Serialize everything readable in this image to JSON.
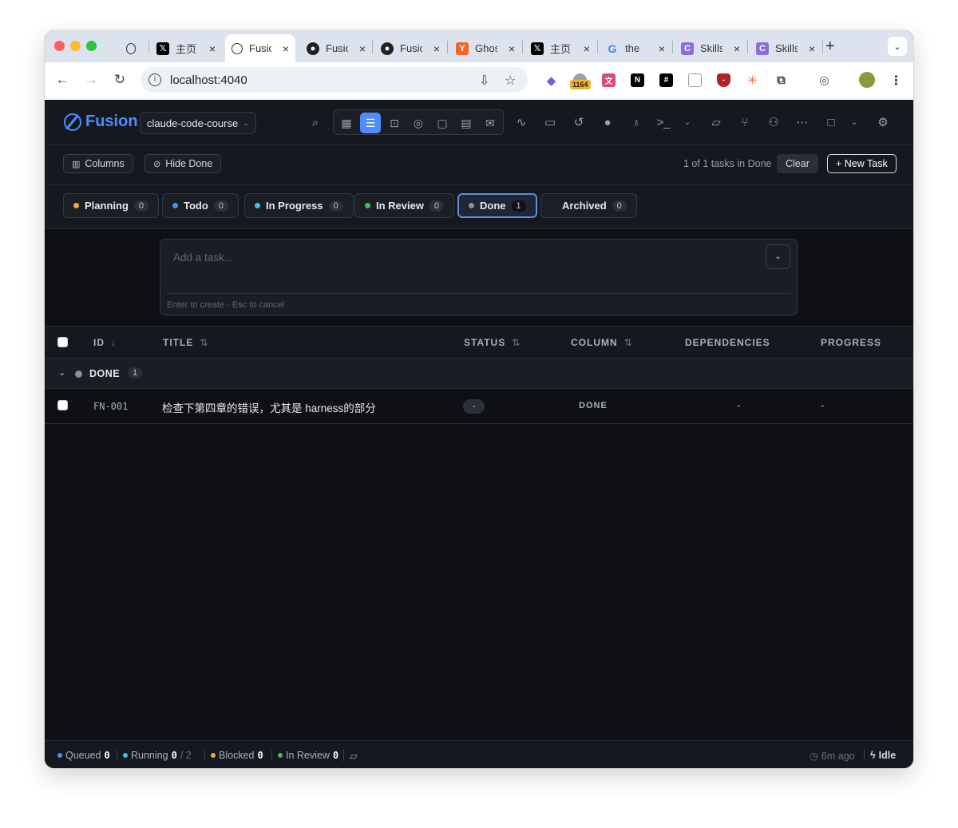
{
  "browser": {
    "tabs": [
      {
        "title": "",
        "icon": "openai-icon"
      },
      {
        "title": "主页",
        "icon": "x-icon"
      },
      {
        "title": "Fusion",
        "icon": "fusion-icon",
        "active": true
      },
      {
        "title": "Fusion",
        "icon": "github-icon"
      },
      {
        "title": "Fusion",
        "icon": "github-icon"
      },
      {
        "title": "Ghost",
        "icon": "ycombinator-icon"
      },
      {
        "title": "主页",
        "icon": "x-icon"
      },
      {
        "title": "the",
        "icon": "google-icon"
      },
      {
        "title": "Skills",
        "icon": "claude-icon"
      },
      {
        "title": "Skills",
        "icon": "claude-icon"
      }
    ],
    "tab_close_glyph": "×",
    "new_tab_glyph": "+",
    "url": "localhost:4040",
    "extension_badge": "1164"
  },
  "app": {
    "logo": "Fusion",
    "project": "claude-code-course",
    "filters": {
      "columns_label": "Columns",
      "hide_done_label": "Hide Done",
      "summary": "1 of 1 tasks in Done",
      "clear_label": "Clear",
      "new_task_label": "+ New Task"
    },
    "column_tabs": [
      {
        "label": "Planning",
        "count": "0",
        "color": "#f0a93b"
      },
      {
        "label": "Todo",
        "count": "0",
        "color": "#4f8cff"
      },
      {
        "label": "In Progress",
        "count": "0",
        "color": "#37c5e8"
      },
      {
        "label": "In Review",
        "count": "0",
        "color": "#3fbf5f"
      },
      {
        "label": "Done",
        "count": "1",
        "color": "#8a8f98",
        "active": true
      },
      {
        "label": "Archived",
        "count": "0",
        "color": ""
      }
    ],
    "composer": {
      "placeholder": "Add a task...",
      "hint": "Enter to create · Esc to cancel"
    },
    "table": {
      "headers": {
        "id": "ID",
        "title": "TITLE",
        "status": "STATUS",
        "column": "COLUMN",
        "dependencies": "DEPENDENCIES",
        "progress": "PROGRESS"
      },
      "group": {
        "label": "DONE",
        "count": "1"
      },
      "rows": [
        {
          "id": "FN-001",
          "title": "检查下第四章的错误，尤其是 harness的部分",
          "status": "-",
          "column": "DONE",
          "dependencies": "-",
          "progress": "-"
        }
      ]
    },
    "statusbar": {
      "queued_label": "Queued",
      "queued_value": "0",
      "running_label": "Running",
      "running_value": "0",
      "running_total": "/ 2",
      "blocked_label": "Blocked",
      "blocked_value": "0",
      "in_review_label": "In Review",
      "in_review_value": "0",
      "time": "6m ago",
      "state": "Idle"
    }
  }
}
